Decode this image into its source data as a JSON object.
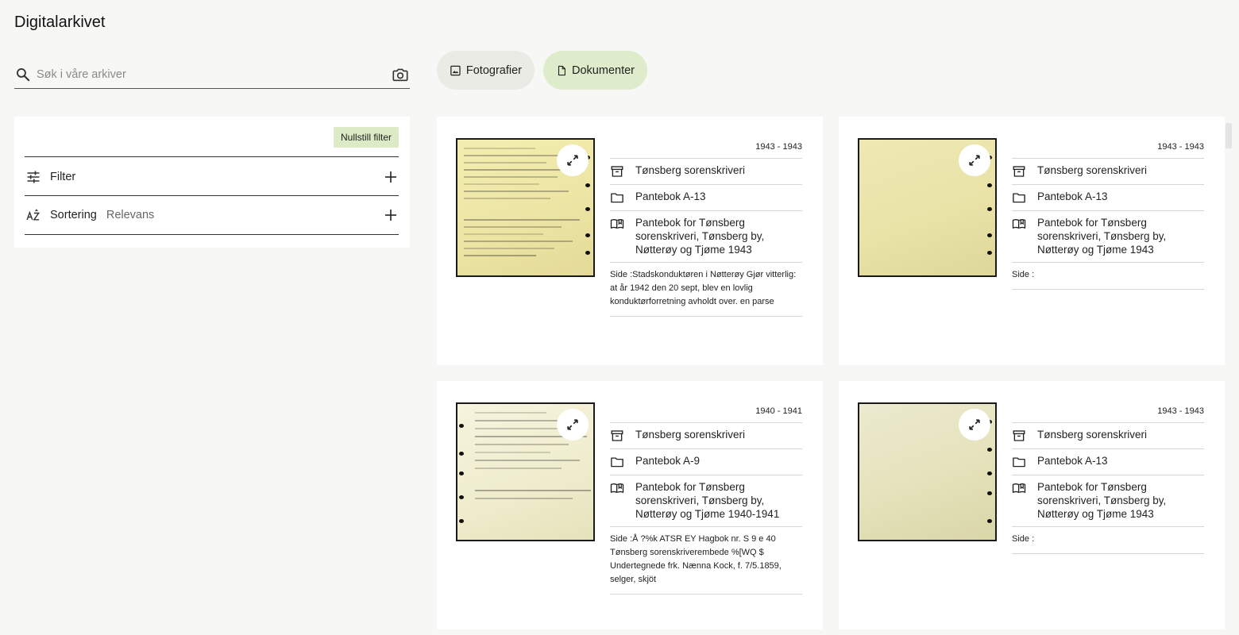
{
  "app": {
    "title": "Digitalarkivet"
  },
  "search": {
    "placeholder": "Søk i våre arkiver"
  },
  "filters": {
    "reset_label": "Nullstill filter",
    "filter_label": "Filter",
    "sort_label": "Sortering",
    "sort_value": "Relevans"
  },
  "chips": [
    {
      "label": "Fotografier",
      "icon": "image-icon",
      "selected": false
    },
    {
      "label": "Dokumenter",
      "icon": "document-icon",
      "selected": true
    }
  ],
  "results": [
    {
      "years": "1943 - 1943",
      "archive": "Tønsberg sorenskriveri",
      "series": "Pantebok A-13",
      "title": "Pantebok for Tønsberg sorenskriveri, Tønsberg by, Nøtterøy og Tjøme 1943",
      "side": "Side :Stadskonduktøren i Nøtterøy Gjør vitterlig: at år 1942 den 20 sept, blev en lovlig konduktørforretning avholdt over. en parse"
    },
    {
      "years": "1943 - 1943",
      "archive": "Tønsberg sorenskriveri",
      "series": "Pantebok A-13",
      "title": "Pantebok for Tønsberg sorenskriveri, Tønsberg by, Nøtterøy og Tjøme 1943",
      "side": "Side :"
    },
    {
      "years": "1940 - 1941",
      "archive": "Tønsberg sorenskriveri",
      "series": "Pantebok A-9",
      "title": "Pantebok for Tønsberg sorenskriveri, Tønsberg by, Nøtterøy og Tjøme 1940-1941",
      "side": "Side :Å ?%k ATSR EY Hagbok nr. S 9 e 40 Tønsberg sorenskriverembede %[WQ $ Undertegnede frk. Nænna Kock, f. 7/5.1859, selger, skjöt"
    },
    {
      "years": "1943 - 1943",
      "archive": "Tønsberg sorenskriveri",
      "series": "Pantebok A-13",
      "title": "Pantebok for Tønsberg sorenskriveri, Tønsberg by, Nøtterøy og Tjøme 1943",
      "side": "Side :"
    }
  ],
  "colors": {
    "background": "#f7f7f5",
    "chip_selected": "#dfeccb",
    "chip_default": "#eaebe4",
    "reset_button": "#dcebc6"
  }
}
